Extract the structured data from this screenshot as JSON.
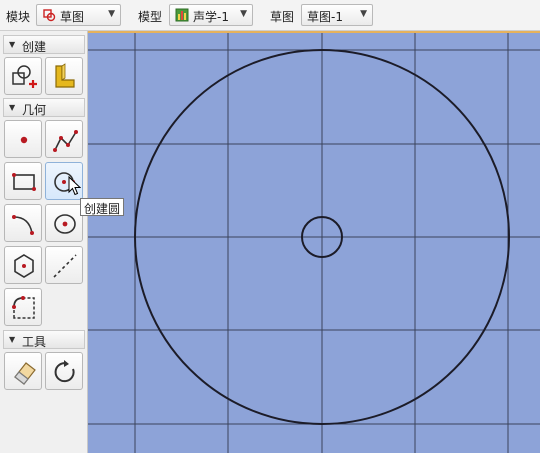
{
  "toolbar": {
    "module_label": "模块",
    "module_value": "草图",
    "model_label": "模型",
    "model_value": "声学-1",
    "sketch_label": "草图",
    "sketch_value": "草图-1",
    "caret": "▼"
  },
  "palette": {
    "sections": [
      {
        "title": "创建"
      },
      {
        "title": "几何"
      },
      {
        "title": "工具"
      }
    ],
    "caret": "▼"
  },
  "tooltip": {
    "text": "创建圆"
  },
  "colors": {
    "canvas_bg": "#8da3d8",
    "grid": "#2c3346",
    "sketch_line": "#1c1c28",
    "accent_point": "#c0202a",
    "cursor_outline": "#000000"
  },
  "icons": [
    "sketch-shape-icon",
    "part-l-icon",
    "point-icon",
    "polyline-icon",
    "rectangle-icon",
    "circle-icon",
    "arc-icon",
    "center-circle-icon",
    "hexagon-icon",
    "construction-line-icon",
    "fillet-icon",
    "eraser-icon",
    "refresh-icon",
    "cursor-icon"
  ]
}
